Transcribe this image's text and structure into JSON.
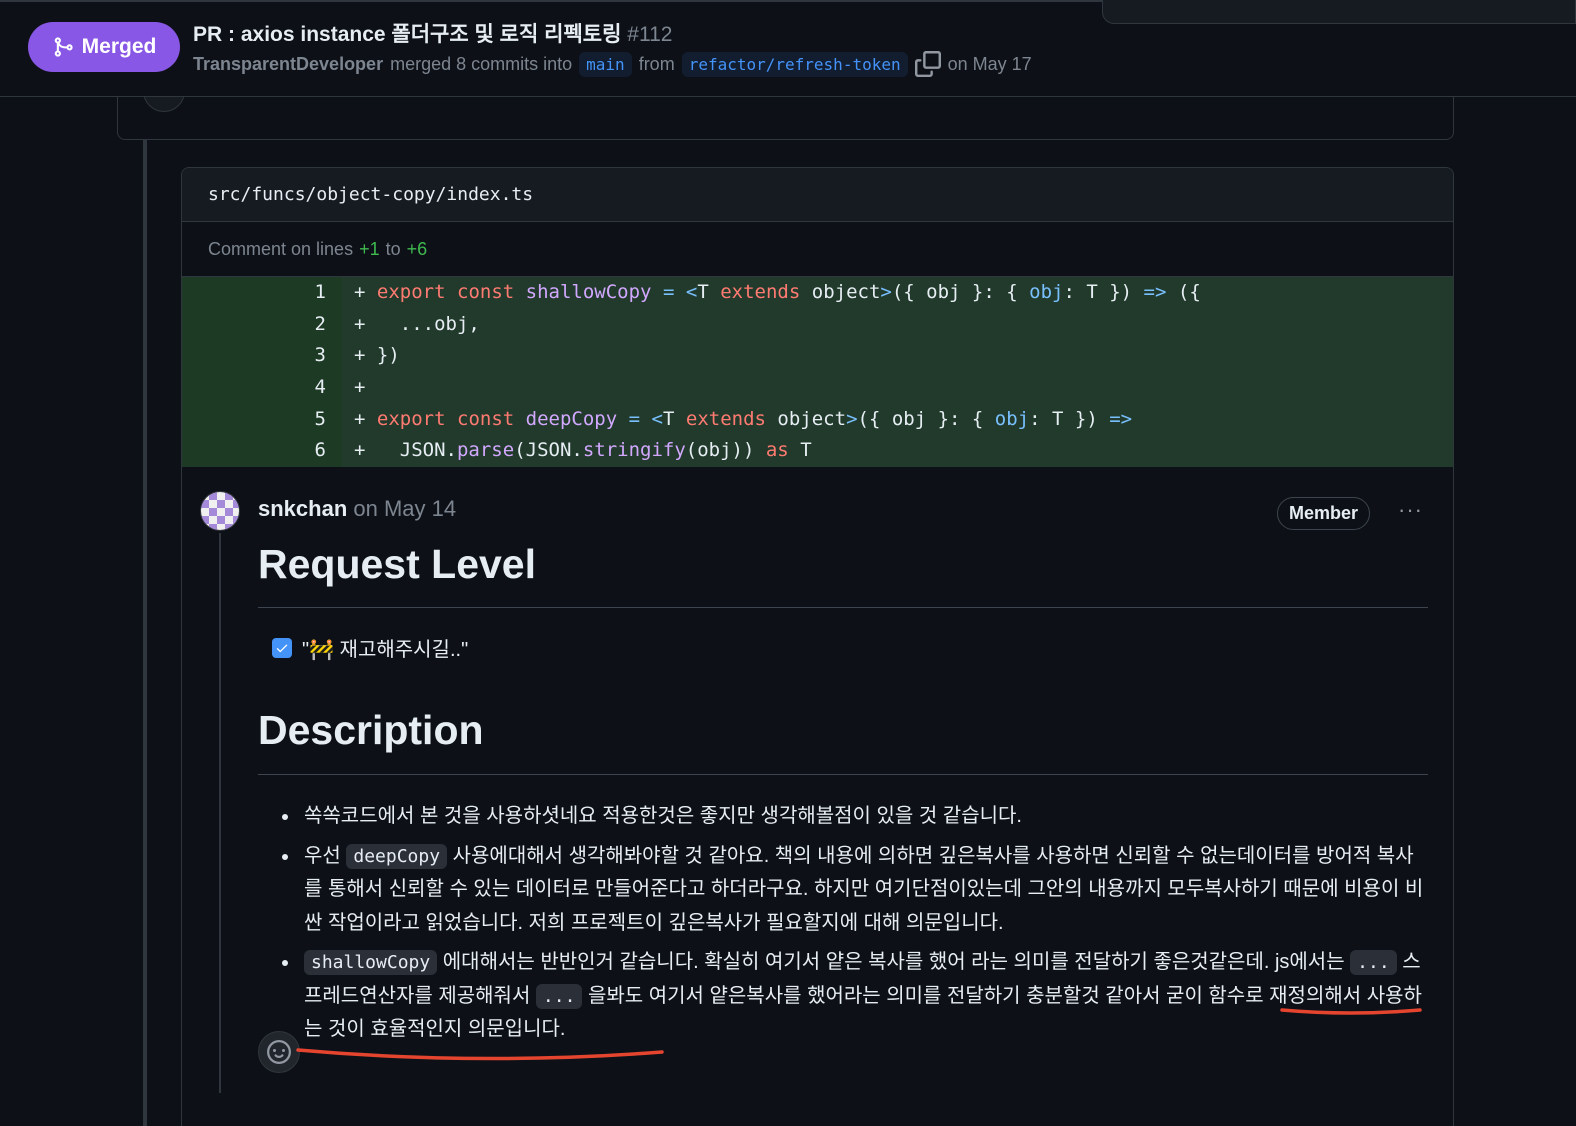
{
  "header": {
    "status": "Merged",
    "title": "PR : axios instance 폴더구조 및 로직 리펙토링",
    "number": "#112",
    "author": "TransparentDeveloper",
    "merged_text": "merged 8 commits into",
    "base_branch": "main",
    "from_text": "from",
    "head_branch": "refactor/refresh-token",
    "date": "on May 17"
  },
  "thread": {
    "file_path": "src/funcs/object-copy/index.ts",
    "comment_on_lines_prefix": "Comment on lines",
    "line_start": "+1",
    "to_text": "to",
    "line_end": "+6",
    "code_lines": [
      {
        "n": "1",
        "plus": "+"
      },
      {
        "n": "2",
        "plus": "+"
      },
      {
        "n": "3",
        "plus": "+"
      },
      {
        "n": "4",
        "plus": "+"
      },
      {
        "n": "5",
        "plus": "+"
      },
      {
        "n": "6",
        "plus": "+"
      }
    ],
    "code_tokens": {
      "export": "export",
      "const": "const",
      "shallowCopy": "shallowCopy",
      "eq": "=",
      "lt": "<",
      "T": "T",
      "extends": "extends",
      "object": "object",
      "gt": ">",
      "args": "({ obj }: { ",
      "obj": "obj",
      "colonT": ": T })",
      "arrow": "=>",
      "open": "({",
      "spread": "  ...obj,",
      "close": "})",
      "deepCopy": "deepCopy",
      "json1": "  JSON.",
      "parse": "parse",
      "json2": "(JSON.",
      "stringify": "stringify",
      "json3": "(obj)) ",
      "as": "as",
      "T2": "T"
    }
  },
  "comment": {
    "author": "snkchan",
    "date": "on May 14",
    "role": "Member",
    "more": "···",
    "heading1": "Request Level",
    "checkbox_label": "\"🚧 재고해주시길..\"",
    "heading2": "Description",
    "bullet1": "쏙쏙코드에서 본 것을 사용하셧네요 적용한것은 좋지만 생각해볼점이 있을 것 같습니다.",
    "bullet2_pre": "우선 ",
    "bullet2_code": "deepCopy",
    "bullet2_post": " 사용에대해서 생각해봐야할 것 같아요. 책의 내용에 의하면 깊은복사를 사용하면 신뢰할 수 없는데이터를 방어적 복사를 통해서 신뢰할 수 있는 데이터로 만들어준다고 하더라구요. 하지만 여기단점이있는데 그안의 내용까지 모두복사하기 때문에 비용이 비싼 작업이라고 읽었습니다. 저희 프로젝트이 깊은복사가 필요할지에 대해 의문입니다.",
    "bullet3_code1": "shallowCopy",
    "bullet3_a": " 에대해서는 반반인거 같습니다. 확실히 여기서 얕은 복사를 했어 라는 의미를 전달하기 좋은것같은데. js에서는 ",
    "bullet3_code2": "...",
    "bullet3_b": " 스프레드연산자를 제공해줘서 ",
    "bullet3_code3": "...",
    "bullet3_c": " 을봐도 여기서 얕은복사를 했어라는 의미를 전달하기 충분할것 같아서 굳이 함수로 재정의해서 사용하는 것이 효율적인지 의문입니다."
  },
  "colors": {
    "merged": "#8957e5",
    "added_line_bg": "#213a2b",
    "annotation_red": "#e5452f"
  }
}
